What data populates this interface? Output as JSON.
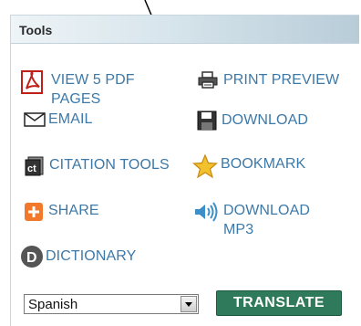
{
  "panel": {
    "title": "Tools"
  },
  "tools": {
    "view_pdf": {
      "label_line1": "VIEW 5 PDF",
      "label_line2": "PAGES",
      "icon": "pdf-icon"
    },
    "print_preview": {
      "label": "PRINT PREVIEW",
      "icon": "printer-icon"
    },
    "email": {
      "label": "EMAIL",
      "icon": "envelope-icon"
    },
    "download": {
      "label": "DOWNLOAD",
      "icon": "floppy-disk-icon"
    },
    "citation_tools": {
      "label": "CITATION TOOLS",
      "icon": "citation-icon"
    },
    "bookmark": {
      "label": "BOOKMARK",
      "icon": "star-icon"
    },
    "share": {
      "label": "SHARE",
      "icon": "plus-icon"
    },
    "download_mp3": {
      "label_line1": "DOWNLOAD",
      "label_line2": "MP3",
      "icon": "speaker-icon"
    },
    "dictionary": {
      "label": "DICTIONARY",
      "icon": "dictionary-d-icon"
    }
  },
  "translate": {
    "language_selected": "Spanish",
    "button_label": "TRANSLATE"
  },
  "colors": {
    "link": "#3d79a8",
    "translate_button": "#2e7a5a",
    "header_gradient_end": "#b8ccd8"
  }
}
